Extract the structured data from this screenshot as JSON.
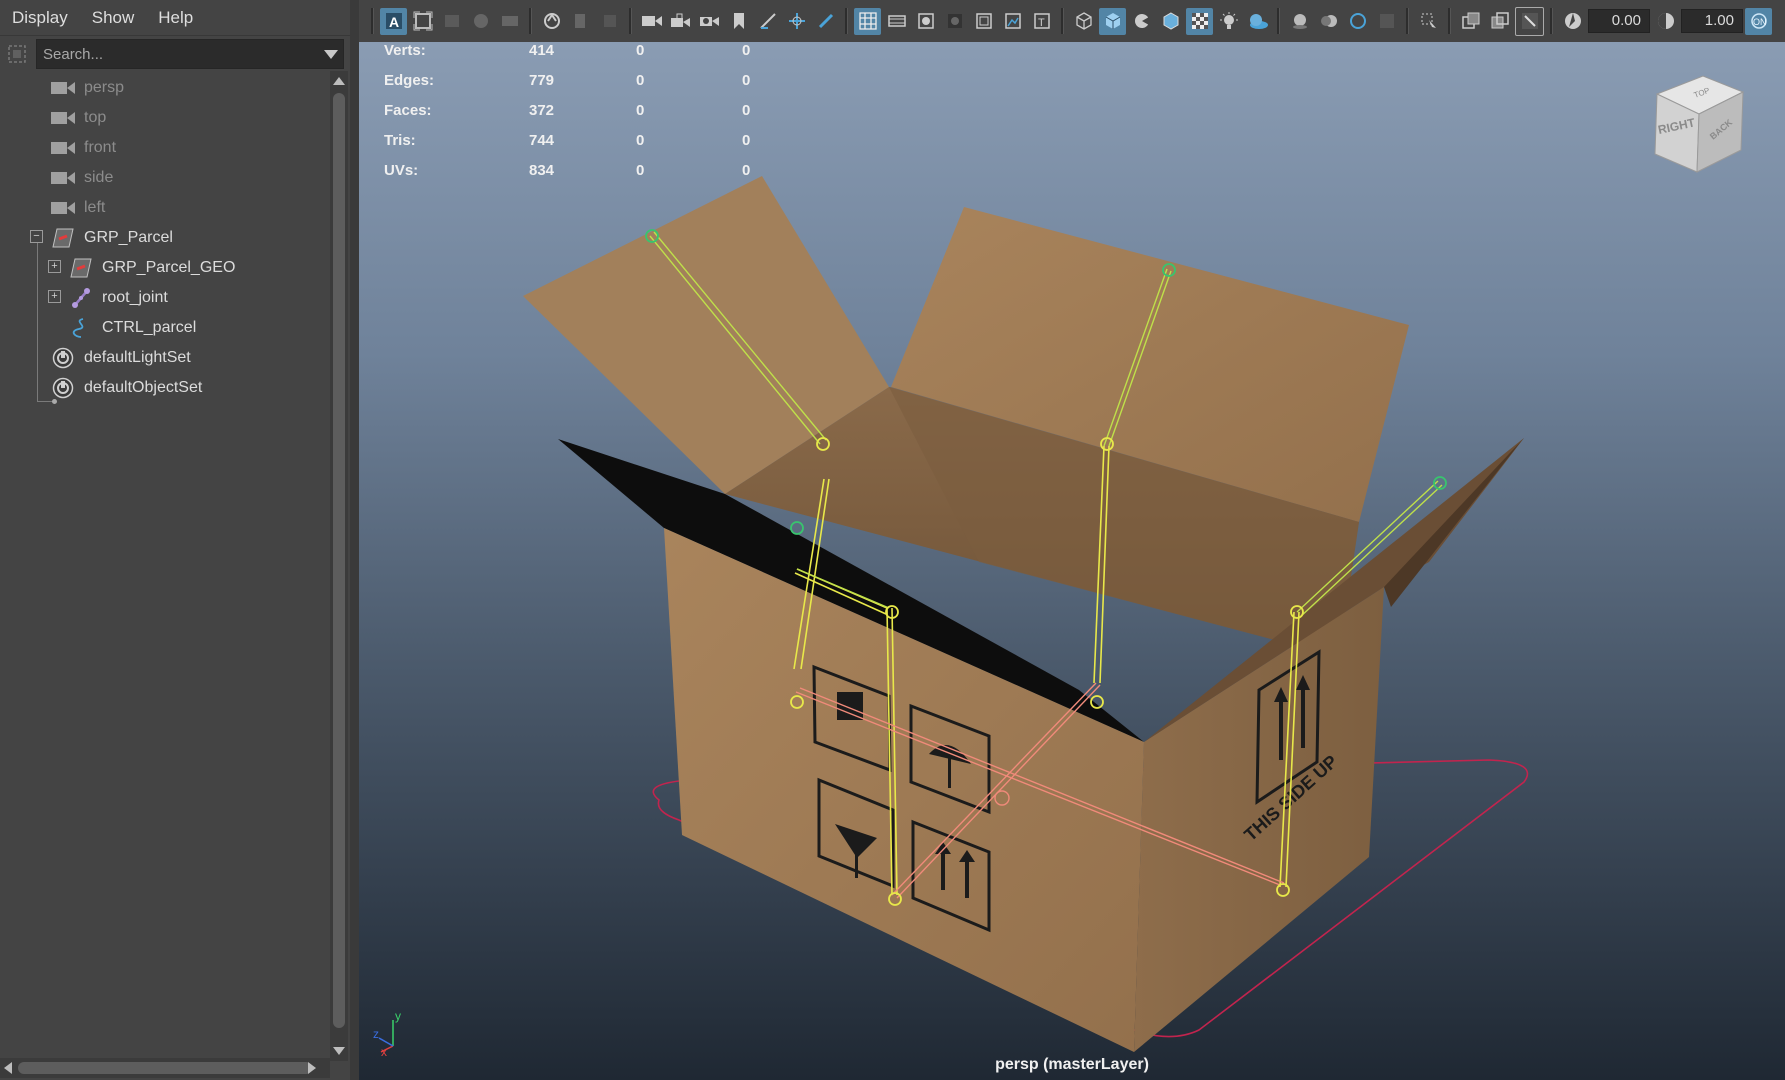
{
  "outliner": {
    "menus": [
      "Display",
      "Show",
      "Help"
    ],
    "search_placeholder": "Search...",
    "items": [
      {
        "label": "persp"
      },
      {
        "label": "top"
      },
      {
        "label": "front"
      },
      {
        "label": "side"
      },
      {
        "label": "left"
      },
      {
        "label": "GRP_Parcel"
      },
      {
        "label": "GRP_Parcel_GEO"
      },
      {
        "label": "root_joint"
      },
      {
        "label": "CTRL_parcel"
      },
      {
        "label": "defaultLightSet"
      },
      {
        "label": "defaultObjectSet"
      }
    ]
  },
  "toolbar": {
    "exposure_value": "0.00",
    "gamma_value": "1.00",
    "accent_color": "#5285a6"
  },
  "hud": {
    "rows": [
      {
        "label": "Verts:",
        "v1": "414",
        "v2": "0",
        "v3": "0"
      },
      {
        "label": "Edges:",
        "v1": "779",
        "v2": "0",
        "v3": "0"
      },
      {
        "label": "Faces:",
        "v1": "372",
        "v2": "0",
        "v3": "0"
      },
      {
        "label": "Tris:",
        "v1": "744",
        "v2": "0",
        "v3": "0"
      },
      {
        "label": "UVs:",
        "v1": "834",
        "v2": "0",
        "v3": "0"
      }
    ]
  },
  "viewport": {
    "panel_label": "persp (masterLayer)",
    "viewcube": {
      "front": "RIGHT",
      "side": "BACK",
      "top": "TOP"
    },
    "box_side_text": "THIS SIDE UP",
    "axis": {
      "x": "x",
      "y": "y",
      "z": "z"
    },
    "colors": {
      "skeleton": "#e8e84a",
      "joint_tip": "#39c46e",
      "ik": "#f08a7a",
      "control": "#c2244e",
      "cardboard": "#a8825c"
    }
  }
}
